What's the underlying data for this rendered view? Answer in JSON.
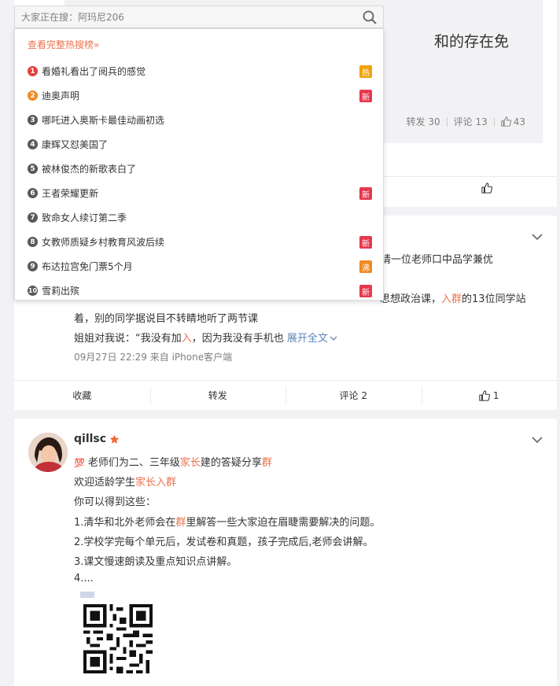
{
  "colors": {
    "accent": "#eb7350",
    "rank_top1": "#e2413c",
    "rank_top2": "#f08a24",
    "rank_default": "#595959",
    "badge_hot": "#f0a30a",
    "badge_new": "#e6384d",
    "badge_boil": "#f08a24",
    "link_blue": "#5d86b6"
  },
  "search": {
    "placeholder": "大家正在搜：阿玛尼206",
    "icon": "search-icon"
  },
  "hot_dropdown": {
    "more_label": "查看完整热搜榜»",
    "items": [
      {
        "rank": "1",
        "text": "看婚礼看出了阅兵的感觉",
        "badge": "热",
        "badge_type": "hot"
      },
      {
        "rank": "2",
        "text": "迪奥声明",
        "badge": "新",
        "badge_type": "new"
      },
      {
        "rank": "3",
        "text": "哪吒进入奥斯卡最佳动画初选",
        "badge": "",
        "badge_type": ""
      },
      {
        "rank": "4",
        "text": "康辉又怼美国了",
        "badge": "",
        "badge_type": ""
      },
      {
        "rank": "5",
        "text": "被林俊杰的新歌表白了",
        "badge": "",
        "badge_type": ""
      },
      {
        "rank": "6",
        "text": "王者荣耀更新",
        "badge": "新",
        "badge_type": "new"
      },
      {
        "rank": "7",
        "text": "致命女人续订第二季",
        "badge": "",
        "badge_type": ""
      },
      {
        "rank": "8",
        "text": "女教师质疑乡村教育风波后续",
        "badge": "新",
        "badge_type": "new"
      },
      {
        "rank": "9",
        "text": "布达拉宫免门票5个月",
        "badge": "沸",
        "badge_type": "boil"
      },
      {
        "rank": "10",
        "text": "雪莉出殡",
        "badge": "新",
        "badge_type": "new"
      }
    ]
  },
  "card1": {
    "quote_title_fragment": "和的存在免",
    "repost": "转发 30",
    "comment": "评论 13",
    "like": "43"
  },
  "card2": {
    "line1_tail": "学邀请一位老师口中品学兼优",
    "line2_pre": "思想政治课，",
    "line2_hl": "入群",
    "line2_post": "的13位同学站",
    "line3": "着，别的同学据说目不转睛地听了两节课",
    "line4_pre": "姐姐对我说：“我没有加",
    "line4_hl": "入",
    "line4_post": "，因为我没有手机也",
    "expand": "展开全文",
    "meta": "09月27日 22:29  来自 iPhone客户端",
    "actions": {
      "collect": "收藏",
      "repost": "转发",
      "comment": "评论 2",
      "like": "1"
    }
  },
  "card3": {
    "username": "qillsc",
    "title_prefix": "💯",
    "title_pre": " 老师们为二、三年级",
    "title_hl1": "家长",
    "title_mid": "建的答疑分享",
    "title_hl2": "群",
    "line2_pre": "欢迎适龄学生",
    "line2_hl": "家长入群",
    "line3": "你可以得到这些：",
    "line4_pre": "1.清华和北外老师会在",
    "line4_hl": "群",
    "line4_post": "里解答一些大家迫在眉睫需要解决的问题。",
    "line5": "2.学校学完每个单元后，发试卷和真题，孩子完成后,老师会讲解。",
    "line6": "3.课文慢速朗读及重点知识点讲解。",
    "line7": "4...."
  }
}
